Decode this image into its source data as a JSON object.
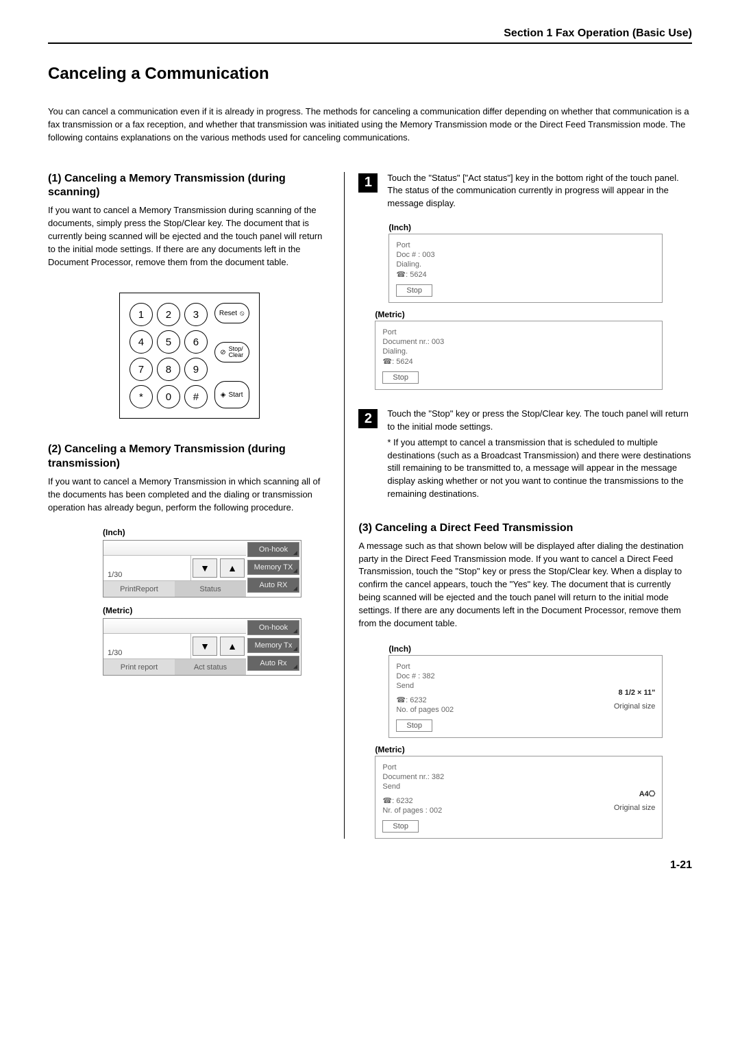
{
  "header": "Section 1  Fax Operation (Basic Use)",
  "title": "Canceling a Communication",
  "intro": "You can cancel a communication even if it is already in progress. The methods for canceling a communication differ depending on whether that communication is a fax transmission or a fax reception, and whether that transmission was initiated using the Memory Transmission mode or the Direct Feed Transmission mode. The following contains explanations on the various methods used for canceling communications.",
  "sec1": {
    "h": "(1) Canceling a Memory Transmission (during scanning)",
    "body": "If you want to cancel a Memory Transmission during scanning of the documents, simply press the Stop/Clear key. The document that is currently being scanned will be ejected and the touch panel will return to the initial mode settings. If there are any documents left in the Document Processor, remove them from the document table."
  },
  "keypad": {
    "keys": [
      "1",
      "2",
      "3",
      "4",
      "5",
      "6",
      "7",
      "8",
      "9",
      "*",
      "0",
      "#"
    ],
    "reset": "Reset",
    "stopclear": "Stop/\nClear",
    "start": "Start"
  },
  "sec2": {
    "h": "(2) Canceling a Memory Transmission (during transmission)",
    "body": "If you want to cancel a Memory Transmission in which scanning all of the documents has been completed and the dialing or transmission operation has already begun, perform the following procedure."
  },
  "labels": {
    "inch": "(Inch)",
    "metric": "(Metric)"
  },
  "lcd_inch": {
    "pages": "1/30",
    "b1": "PrintReport",
    "b2": "Status",
    "s1": "On-hook",
    "s2": "Memory TX",
    "s3": "Auto RX"
  },
  "lcd_metric": {
    "pages": "1/30",
    "b1": "Print report",
    "b2": "Act status",
    "s1": "On-hook",
    "s2": "Memory Tx",
    "s3": "Auto Rx"
  },
  "step1": {
    "n": "1",
    "a": "Touch the \"Status\" [\"Act status\"] key in the bottom right of the touch panel.",
    "b": "The status of the communication currently in progress will appear in the message display."
  },
  "panel1_inch": {
    "l1": "Port",
    "l2": "Doc # : 003",
    "l3": "Dialing.",
    "l4": "☎: 5624",
    "stop": "Stop"
  },
  "panel1_metric": {
    "l1": "Port",
    "l2": "Document nr.: 003",
    "l3": "Dialing.",
    "l4": "☎: 5624",
    "stop": "Stop"
  },
  "step2": {
    "n": "2",
    "a": "Touch the \"Stop\" key or press the Stop/Clear key. The touch panel will return to the initial mode settings.",
    "note": "* If you attempt to cancel a transmission that is scheduled to multiple destinations (such as a Broadcast Transmission) and there were destinations still remaining to be transmitted to, a message will appear in the message display asking whether or not you want to continue the transmissions to the remaining destinations."
  },
  "sec3": {
    "h": "(3) Canceling a Direct Feed Transmission",
    "body": "A message such as that shown below will be displayed after dialing the destination party in the Direct Feed Transmission mode. If you want to cancel a Direct Feed Transmission, touch the \"Stop\" key or press the Stop/Clear key. When a display to confirm the cancel appears, touch the \"Yes\" key.  The document that is currently being scanned will be ejected and the touch panel will return to the initial mode settings. If there are any documents left in the Document Processor, remove them from the document table."
  },
  "panel3_inch": {
    "l1": "Port",
    "l2": "Doc # : 382",
    "l3": "Send",
    "l4": "☎: 6232",
    "l5": "No. of pages   002",
    "r1": "8 1/2 × 11\"",
    "r2": "Original size",
    "stop": "Stop"
  },
  "panel3_metric": {
    "l1": "Port",
    "l2": "Document nr.: 382",
    "l3": "Send",
    "l4": "☎: 6232",
    "l5": "Nr. of pages  : 002",
    "r1": "A4⎔",
    "r2": "Original size",
    "stop": "Stop"
  },
  "pagenum": "1-21"
}
